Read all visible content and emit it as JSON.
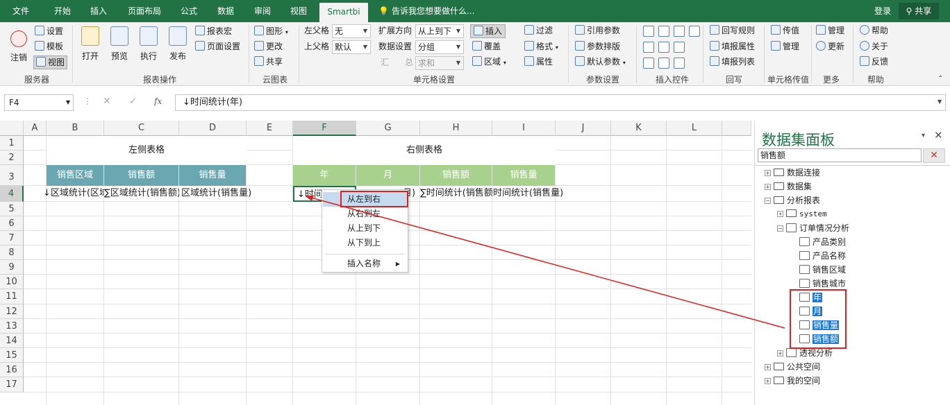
{
  "menubar": {
    "tabs": [
      "文件",
      "开始",
      "插入",
      "页面布局",
      "公式",
      "数据",
      "审阅",
      "视图",
      "Smartbi"
    ],
    "tellme": "告诉我您想要做什么...",
    "login": "登录",
    "share": "共享"
  },
  "ribbon": {
    "server": {
      "logout": "注销",
      "settings": "设置",
      "template": "模板",
      "view": "视图",
      "label": "服务器"
    },
    "report": {
      "open": "打开",
      "preview": "预览",
      "execute": "执行",
      "publish": "发布",
      "macro": "报表宏",
      "page_setup": "页面设置",
      "label": "报表操作"
    },
    "cloud": {
      "chart": "图形",
      "update": "更改",
      "share": "共享",
      "label": "云图表"
    },
    "cell_settings": {
      "left_parent": "左父格",
      "left_parent_val": "无",
      "top_parent": "上父格",
      "top_parent_val": "默认",
      "expand_dir": "扩展方向",
      "expand_dir_val": "从上到下",
      "data_settings": "数据设置",
      "data_settings_val": "分组",
      "agg": "汇",
      "total": "总",
      "agg_val": "求和",
      "insert": "插入",
      "cover": "覆盖",
      "area": "区域",
      "filter": "过滤",
      "format": "格式",
      "attr": "属性",
      "label": "单元格设置"
    },
    "params": {
      "ref": "引用参数",
      "layout": "参数排版",
      "default": "默认参数",
      "label": "参数设置"
    },
    "controls": {
      "label": "插入控件"
    },
    "writeback": {
      "rule": "回写规则",
      "attr": "填报属性",
      "list": "填报列表",
      "label": "回写"
    },
    "cellpass": {
      "pass": "传值",
      "manage": "管理",
      "label": "单元格传值"
    },
    "more": {
      "manage": "管理",
      "update": "更新",
      "label": "更多"
    },
    "help": {
      "help": "帮助",
      "about": "关于",
      "feedback": "反馈",
      "label": "帮助"
    }
  },
  "formula_bar": {
    "namebox": "F4",
    "formula": "↓时间统计(年)"
  },
  "grid": {
    "columns": [
      "A",
      "B",
      "C",
      "D",
      "E",
      "F",
      "G",
      "H",
      "I",
      "J",
      "K",
      "L"
    ],
    "rows": [
      "1",
      "2",
      "3",
      "4",
      "5",
      "6",
      "7",
      "8",
      "9",
      "10",
      "11",
      "12",
      "13",
      "14",
      "15",
      "16",
      "17"
    ],
    "left_title": "左侧表格",
    "right_title": "右侧表格",
    "left_headers": [
      "销售区域",
      "销售额",
      "销售量"
    ],
    "right_headers": [
      "年",
      "月",
      "销售额",
      "销售量"
    ],
    "row4_b": "↓区域统计(区域)",
    "row4_c": "∑区域统计(销售额)",
    "row4_d": "区域统计(销售量)",
    "row4_f": "↓时间统",
    "row4_g": "月)",
    "row4_h": "∑时间统计(销售额)",
    "row4_i": "时间统计(销售量)"
  },
  "context_menu": {
    "items": [
      "从左到右",
      "从右到左",
      "从上到下",
      "从下到上"
    ],
    "insert_name": "插入名称"
  },
  "panel": {
    "title": "数据集面板",
    "search_value": "销售额",
    "tree": [
      {
        "label": "数据连接",
        "level": 0
      },
      {
        "label": "数据集",
        "level": 0
      },
      {
        "label": "分析报表",
        "level": 0
      },
      {
        "label": "system",
        "level": 1
      },
      {
        "label": "订单情况分析",
        "level": 1
      },
      {
        "label": "产品类别",
        "level": 2
      },
      {
        "label": "产品名称",
        "level": 2
      },
      {
        "label": "销售区域",
        "level": 2
      },
      {
        "label": "销售城市",
        "level": 2
      },
      {
        "label": "年",
        "level": 2
      },
      {
        "label": "月",
        "level": 2
      },
      {
        "label": "销售量",
        "level": 2
      },
      {
        "label": "销售额",
        "level": 2
      },
      {
        "label": "透视分析",
        "level": 1
      },
      {
        "label": "公共空间",
        "level": 0
      },
      {
        "label": "我的空间",
        "level": 0
      }
    ]
  },
  "colors": {
    "excel_green": "#217346",
    "header_blue": "#6ba7b0",
    "header_green": "#a9d18e",
    "highlight_red": "#e02020",
    "select_blue": "#1e78d6"
  }
}
